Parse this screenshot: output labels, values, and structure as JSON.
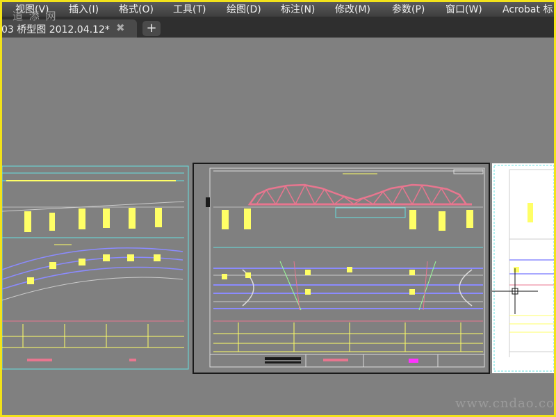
{
  "menu": {
    "items": [
      "视图(V)",
      "插入(I)",
      "格式(O)",
      "工具(T)",
      "绘图(D)",
      "标注(N)",
      "修改(M)",
      "参数(P)",
      "窗口(W)",
      "Acrobat 标"
    ]
  },
  "tabs": {
    "active_title": "03 桥型图 2012.04.12*",
    "close_glyph": "✖",
    "new_tab_glyph": "+"
  },
  "watermark": {
    "top": "道 添 网",
    "bottom": "www.cndao.com"
  },
  "colors": {
    "background": "#808080",
    "frame": "#f2e21a",
    "cyan": "#66e0e0",
    "yellow": "#ffff66",
    "pink": "#e8768f",
    "blue": "#8b8bff"
  }
}
